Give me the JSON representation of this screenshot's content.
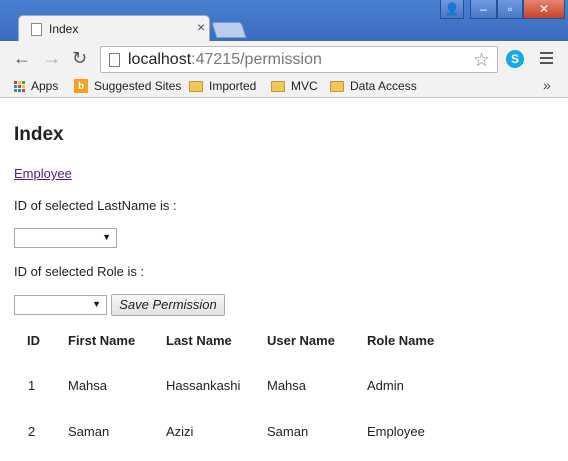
{
  "browser": {
    "tab_title": "Index",
    "tab_close": "×",
    "url_host": "localhost",
    "url_rest": ":47215/permission",
    "back_glyph": "←",
    "forward_glyph": "→",
    "reload_glyph": "↻",
    "star_glyph": "☆",
    "skype_glyph": "S",
    "window_controls": {
      "user": "👤",
      "minimize": "–",
      "maximize": "▫",
      "close": "✕"
    }
  },
  "bookmarks": {
    "items": [
      {
        "label": "Apps",
        "icon": "apps-grid-icon"
      },
      {
        "label": "Suggested Sites",
        "icon": "bing-icon"
      },
      {
        "label": "Imported",
        "icon": "folder-icon"
      },
      {
        "label": "MVC",
        "icon": "folder-icon"
      },
      {
        "label": "Data Access",
        "icon": "folder-icon"
      }
    ],
    "overflow": "»"
  },
  "page": {
    "heading": "Index",
    "employee_link": "Employee",
    "lastname_label": "ID of selected LastName is :",
    "role_label": "ID of selected Role is :",
    "lastname_select_value": "",
    "role_select_value": "",
    "save_button": "Save Permission",
    "table": {
      "headers": [
        "ID",
        "First Name",
        "Last Name",
        "User Name",
        "Role Name"
      ],
      "rows": [
        [
          "1",
          "Mahsa",
          "Hassankashi",
          "Mahsa",
          "Admin"
        ],
        [
          "2",
          "Saman",
          "Azizi",
          "Saman",
          "Employee"
        ]
      ]
    }
  },
  "colors": {
    "titlebar": "#3a6cc0",
    "link": "#551a8b",
    "bing": "#f5a31a",
    "skype": "#17a9e6",
    "folder": "#f0c75a"
  }
}
